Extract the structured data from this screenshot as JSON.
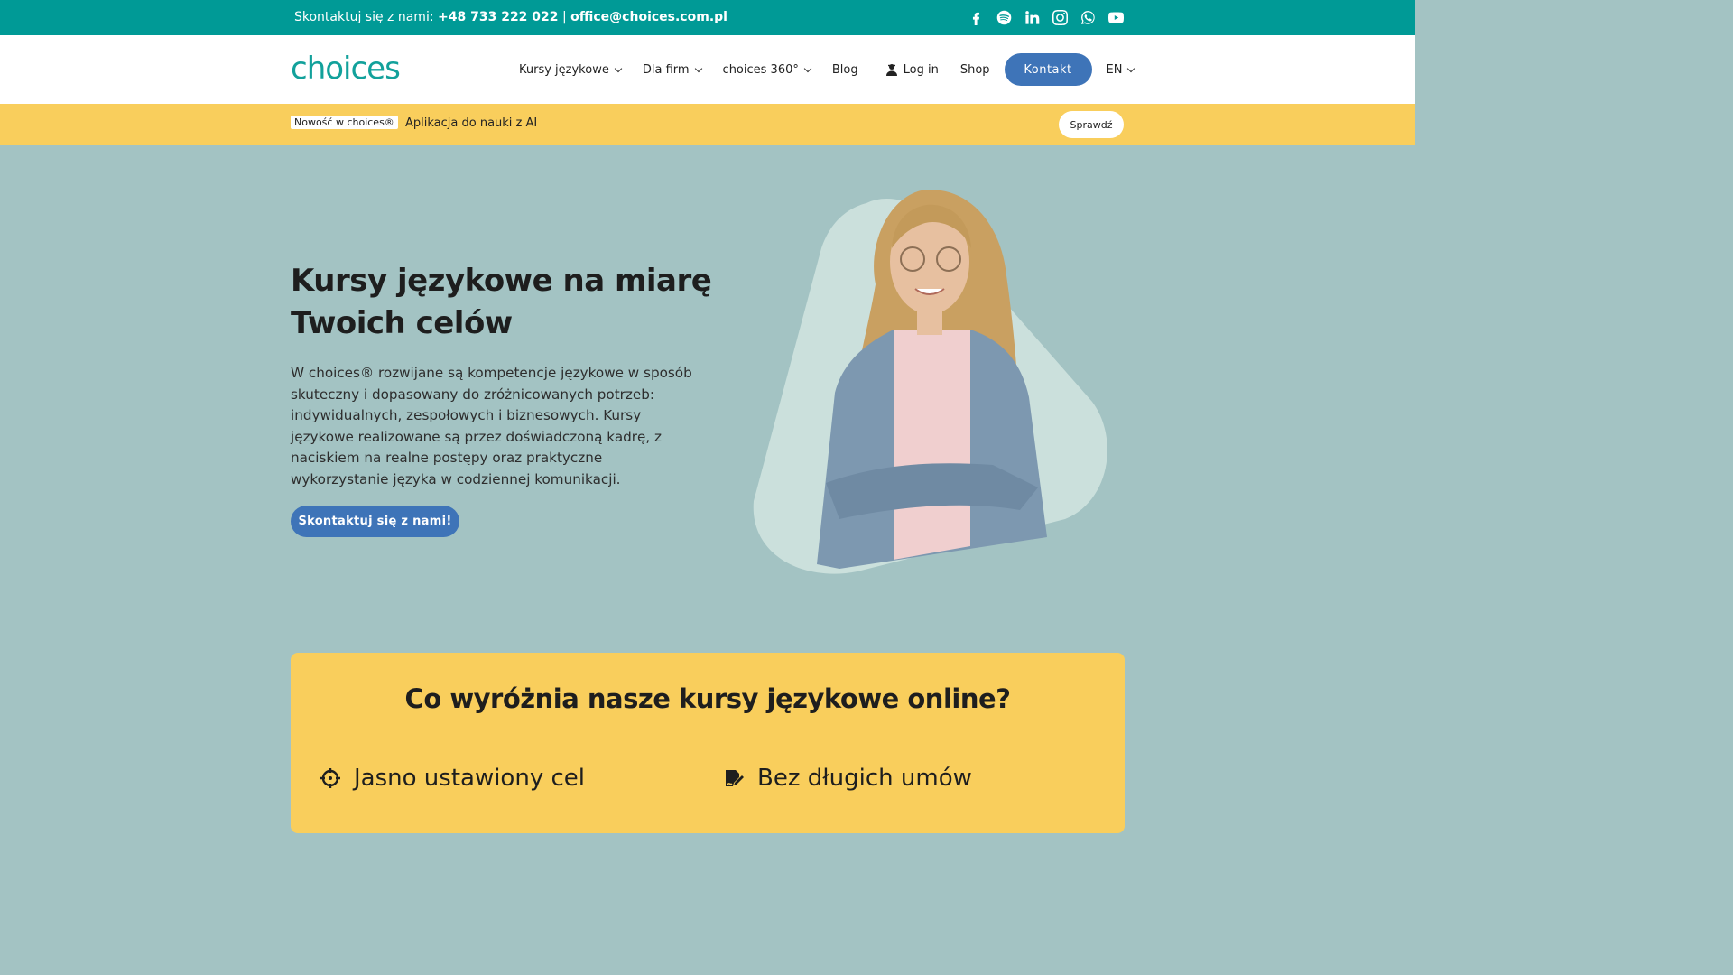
{
  "topbar": {
    "contact_prefix": "Skontaktuj się z nami:",
    "phone": "+48 733 222 022",
    "separator": "|",
    "email": "office@choices.com.pl",
    "socials": [
      "facebook-icon",
      "spotify-icon",
      "linkedin-icon",
      "instagram-icon",
      "whatsapp-icon",
      "youtube-icon"
    ]
  },
  "header": {
    "logo": "choices",
    "nav": {
      "courses": "Kursy językowe",
      "business": "Dla firm",
      "choices360": "choices 360°",
      "blog": "Blog",
      "login": "Log in",
      "shop": "Shop",
      "contact": "Kontakt",
      "lang": "EN"
    }
  },
  "promo": {
    "badge": "Nowość w choices®",
    "text": "Aplikacja do nauki z AI",
    "button": "Sprawdź"
  },
  "hero": {
    "title": "Kursy językowe na miarę Twoich celów",
    "description": "W choices® rozwijane są kompetencje językowe w sposób skuteczny i dopasowany do zróżnicowanych potrzeb: indywidualnych, zespołowych i biznesowych. Kursy językowe realizowane są przez doświadczoną kadrę, z naciskiem na realne postępy oraz praktyczne wykorzystanie języka w codziennej komunikacji.",
    "cta": "Skontaktuj się z nami!"
  },
  "features": {
    "title": "Co wyróżnia nasze kursy językowe online?",
    "items": [
      {
        "label": "Jasno ustawiony cel",
        "icon": "crosshair-icon"
      },
      {
        "label": "Bez długich umów",
        "icon": "signature-icon"
      }
    ]
  },
  "colors": {
    "teal": "#009a96",
    "accent_blue": "#3e74b8",
    "yellow": "#f9ce5c",
    "hero_bg": "#a3c3c3"
  }
}
